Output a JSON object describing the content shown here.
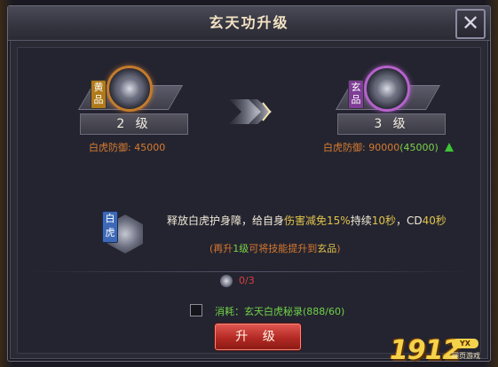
{
  "title": "玄天功升级",
  "close_icon": "close-icon",
  "current": {
    "rank_tag": "黄品",
    "level": "2 级",
    "defense_label": "白虎防御:",
    "defense_value": "45000"
  },
  "next": {
    "rank_tag": "玄品",
    "level": "3 级",
    "defense_label": "白虎防御:",
    "defense_value": "90000",
    "defense_gain": "(45000)"
  },
  "effect": {
    "tag": "白虎",
    "line_parts": [
      "释放白虎护身障，给自身",
      "伤害减免15%",
      "持续",
      "10秒",
      "，CD",
      "40秒"
    ],
    "note_parts": [
      "(再升",
      "1级",
      "可将技能提升到",
      "玄品",
      ")"
    ]
  },
  "item": {
    "icon": "stone-icon",
    "count": "0/3"
  },
  "cost": {
    "text": "消耗：玄天白虎秘录(888/60)"
  },
  "upgrade_button": "升 级",
  "watermark": {
    "big": "1912",
    "badge": "YX",
    "sub": "网页游戏"
  }
}
